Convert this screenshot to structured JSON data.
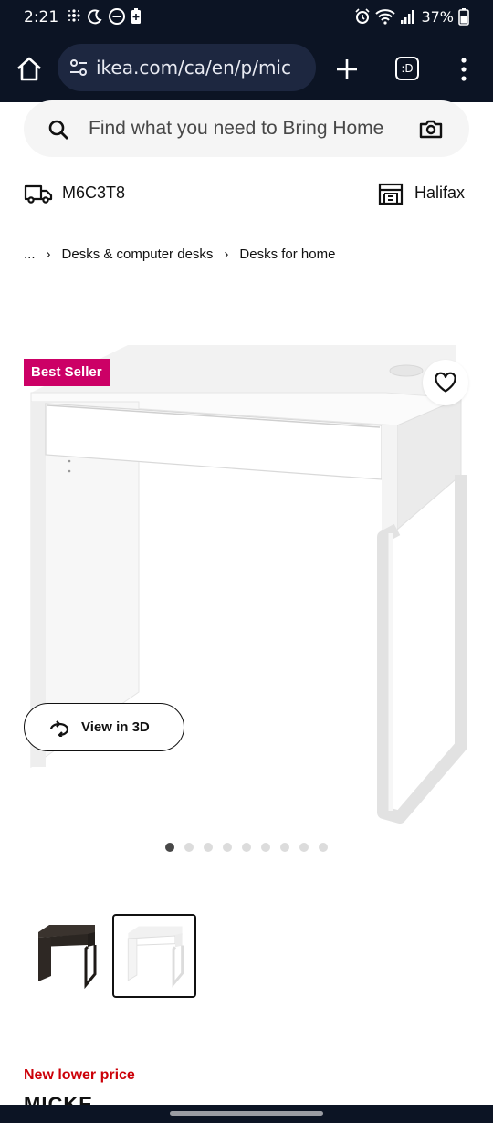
{
  "status_bar": {
    "time": "2:21",
    "battery": "37%"
  },
  "browser": {
    "url": "ikea.com/ca/en/p/mic",
    "tab_label": ":D"
  },
  "search": {
    "placeholder": "Find what you need to Bring Home"
  },
  "location": {
    "postal_code": "M6C3T8",
    "store": "Halifax"
  },
  "breadcrumb": {
    "ellipsis": "...",
    "items": [
      "Desks & computer desks",
      "Desks for home"
    ]
  },
  "product": {
    "badge": "Best Seller",
    "view_3d_label": "View in 3D",
    "image_count": 9,
    "active_image_index": 0,
    "price_tag": "New lower price",
    "name": "MICKE"
  },
  "colors": {
    "badge": "#cc0066",
    "price_tag": "#cc0008",
    "system_bar": "#0c1424"
  },
  "icons": [
    "home-icon",
    "site-info-icon",
    "plus-icon",
    "tab-switcher-icon",
    "more-vert-icon",
    "search-icon",
    "camera-icon",
    "truck-icon",
    "store-icon",
    "heart-icon",
    "rotate-3d-icon"
  ]
}
